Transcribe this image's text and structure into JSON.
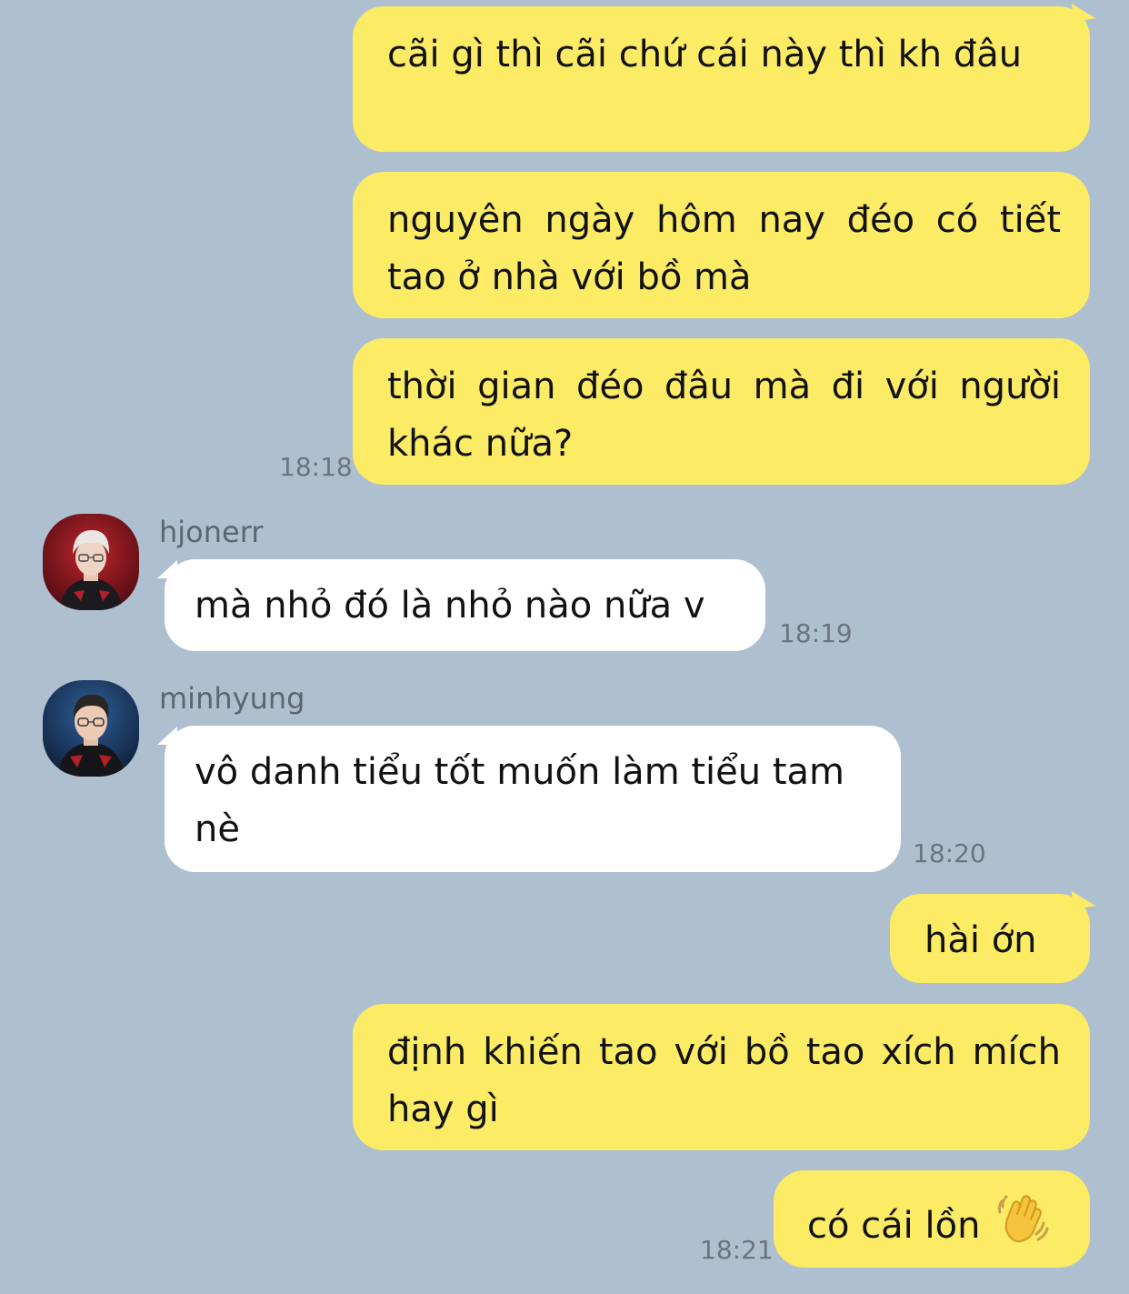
{
  "messages": [
    {
      "side": "me",
      "text": "cãi gì thì cãi chứ cái này thì kh đâu"
    },
    {
      "side": "me",
      "text": "nguyên ngày hôm nay đéo có tiết tao ở nhà với bồ mà"
    },
    {
      "side": "me",
      "text": "thời gian đéo đâu mà đi với người khác nữa?",
      "time": "18:18"
    },
    {
      "side": "them",
      "sender": "hjonerr",
      "avatar_icon": "profile-photo-hjonerr",
      "text": "mà nhỏ đó là nhỏ nào nữa v",
      "time": "18:19"
    },
    {
      "side": "them",
      "sender": "minhyung",
      "avatar_icon": "profile-photo-minhyung",
      "text": "vô danh tiểu tốt muốn làm tiểu tam nè",
      "time": "18:20"
    },
    {
      "side": "me",
      "text": "hài ớn"
    },
    {
      "side": "me",
      "text": "định khiến tao với bồ tao xích mích hay gì"
    },
    {
      "side": "me",
      "text": "có cái lồn",
      "emoji": "waving-hand-icon",
      "time": "18:21"
    }
  ],
  "colors": {
    "background": "#aec0d0",
    "my_bubble": "#fbeb65",
    "their_bubble": "#ffffff",
    "timestamp": "#6b7480",
    "sender_name": "#5c6670"
  }
}
